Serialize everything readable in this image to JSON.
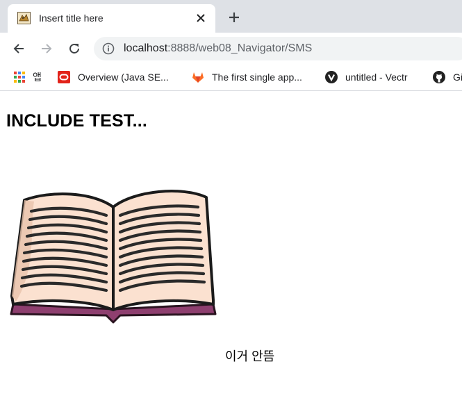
{
  "browser": {
    "tab": {
      "title": "Insert title here"
    },
    "address": {
      "host": "localhost",
      "path": ":8888/web08_Navigator/SMS"
    },
    "bookmarks": [
      {
        "label": "앱",
        "icon": "apps-grid-icon"
      },
      {
        "label": "Overview (Java SE...",
        "icon": "oracle-icon"
      },
      {
        "label": "The first single app...",
        "icon": "gitlab-icon"
      },
      {
        "label": "untitled - Vectr",
        "icon": "vectr-icon"
      },
      {
        "label": "Gi",
        "icon": "github-icon"
      }
    ]
  },
  "page": {
    "heading": "INCLUDE TEST...",
    "image": {
      "subject": "open-book-icon"
    },
    "caption": "이거 안뜸"
  },
  "colors": {
    "tabstrip": "#dee1e6",
    "omnibox": "#f1f3f4",
    "book_pages": "#fbe1d0",
    "book_cover": "#8e3f6f"
  }
}
